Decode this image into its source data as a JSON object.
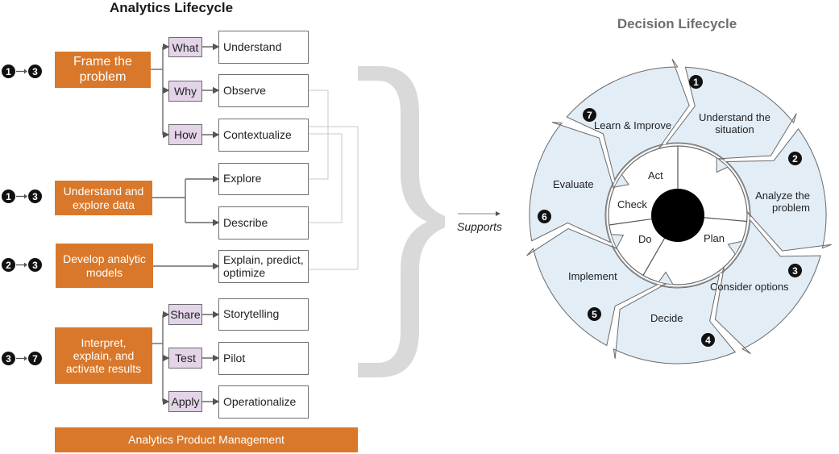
{
  "analytics": {
    "title": "Analytics Lifecycle",
    "stages": [
      {
        "label": "Frame the problem",
        "badge_from": "1",
        "badge_to": "3",
        "questions": [
          {
            "q": "What",
            "task": "Understand"
          },
          {
            "q": "Why",
            "task": "Observe"
          },
          {
            "q": "How",
            "task": "Contextualize"
          }
        ]
      },
      {
        "label": "Understand and explore data",
        "badge_from": "1",
        "badge_to": "3",
        "tasks": [
          "Explore",
          "Describe"
        ]
      },
      {
        "label": "Develop analytic models",
        "badge_from": "2",
        "badge_to": "3",
        "tasks": [
          "Explain, predict, optimize"
        ]
      },
      {
        "label": "Interpret, explain, and activate results",
        "badge_from": "3",
        "badge_to": "7",
        "questions": [
          {
            "q": "Share",
            "task": "Storytelling"
          },
          {
            "q": "Test",
            "task": "Pilot"
          },
          {
            "q": "Apply",
            "task": "Operationalize"
          }
        ]
      }
    ],
    "footer": "Analytics Product Management"
  },
  "connector": {
    "label": "Supports"
  },
  "decision": {
    "title": "Decision Lifecycle",
    "steps": [
      {
        "num": "1",
        "label": "Understand the situation"
      },
      {
        "num": "2",
        "label": "Analyze the problem"
      },
      {
        "num": "3",
        "label": "Consider options"
      },
      {
        "num": "4",
        "label": "Decide"
      },
      {
        "num": "5",
        "label": "Implement"
      },
      {
        "num": "6",
        "label": "Evaluate"
      },
      {
        "num": "7",
        "label": "Learn & Improve"
      }
    ],
    "inner": [
      "Plan",
      "Do",
      "Check",
      "Act"
    ]
  },
  "colors": {
    "orange": "#d9782a",
    "purple": "#e3d4e8",
    "wheel_fill": "#e2edf6",
    "brace": "#d9d9d9"
  }
}
